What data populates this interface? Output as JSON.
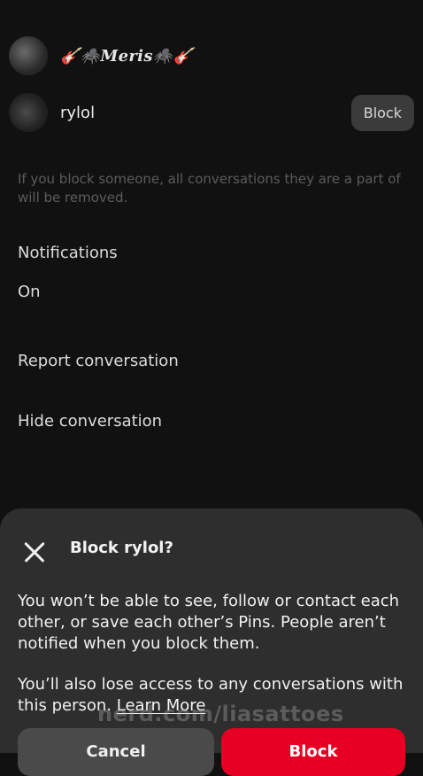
{
  "members": [
    {
      "name": "🎸🕷️Meris🕷️🎸"
    },
    {
      "name": "rylol",
      "block_label": "Block"
    }
  ],
  "block_info": "If you block someone, all conversations they are a part of will be removed.",
  "notifications": {
    "label": "Notifications",
    "value": "On"
  },
  "actions": {
    "report": "Report conversation",
    "hide": "Hide conversation"
  },
  "dialog": {
    "title": "Block rylol?",
    "paragraph1": "You won’t be able to see, follow or contact each other, or save each other’s Pins. People aren’t notified when you block them.",
    "paragraph2": "You’ll also lose access to any conversations with this person.",
    "learn_more": "Learn More",
    "cancel_label": "Cancel",
    "block_label": "Block"
  },
  "watermark": "nerd.com/liasattoes",
  "colors": {
    "background": "#111111",
    "sheet": "#2e2e2e",
    "block_red": "#e60023"
  }
}
